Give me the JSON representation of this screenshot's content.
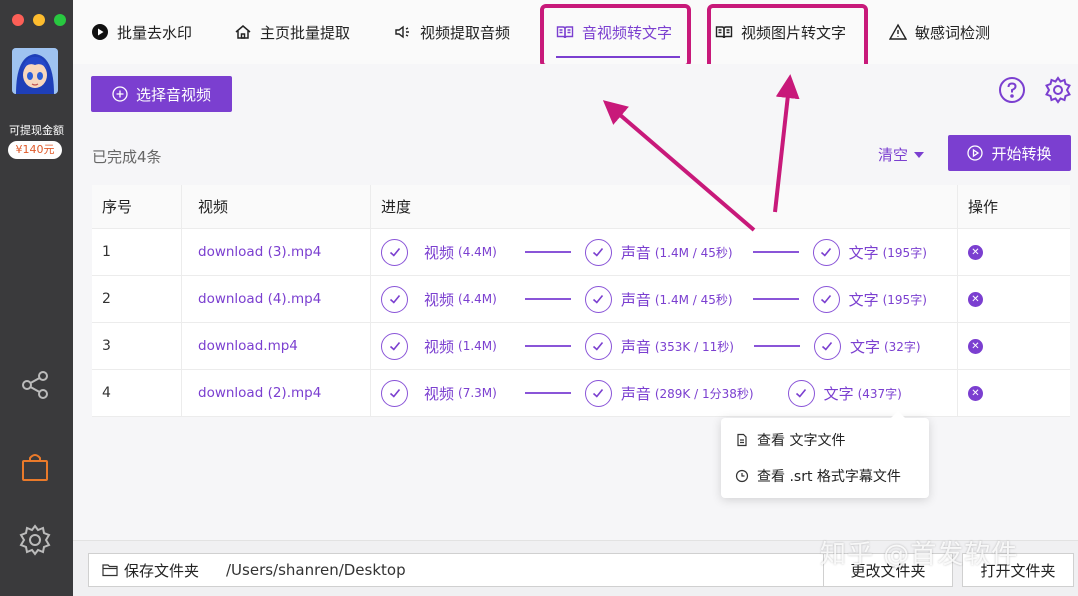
{
  "sidebar": {
    "balance_label": "可提现金额",
    "balance_value": "¥140元"
  },
  "tabs": [
    {
      "label": "批量去水印",
      "icon": "play-circle-icon"
    },
    {
      "label": "主页批量提取",
      "icon": "home-icon"
    },
    {
      "label": "视频提取音频",
      "icon": "speaker-icon"
    },
    {
      "label": "音视频转文字",
      "icon": "book-icon",
      "active": true
    },
    {
      "label": "视频图片转文字",
      "icon": "book-icon"
    },
    {
      "label": "敏感词检测",
      "icon": "warning-icon"
    }
  ],
  "toolbar": {
    "select_label": "选择音视频",
    "done_text": "已完成4条",
    "clear_label": "清空",
    "start_label": "开始转换"
  },
  "table": {
    "headers": [
      "序号",
      "视频",
      "进度",
      "操作"
    ],
    "rows": [
      {
        "num": "1",
        "file": "download (3).mp4",
        "video": "视频",
        "video_sub": "(4.4M)",
        "audio": "声音",
        "audio_sub": "(1.4M / 45秒)",
        "text": "文字",
        "text_sub": "(195字)"
      },
      {
        "num": "2",
        "file": "download (4).mp4",
        "video": "视频",
        "video_sub": "(4.4M)",
        "audio": "声音",
        "audio_sub": "(1.4M / 45秒)",
        "text": "文字",
        "text_sub": "(195字)"
      },
      {
        "num": "3",
        "file": "download.mp4",
        "video": "视频",
        "video_sub": "(1.4M)",
        "audio": "声音",
        "audio_sub": "(353K / 11秒)",
        "text": "文字",
        "text_sub": "(32字)"
      },
      {
        "num": "4",
        "file": "download (2).mp4",
        "video": "视频",
        "video_sub": "(7.3M)",
        "audio": "声音",
        "audio_sub": "(289K / 1分38秒)",
        "text": "文字",
        "text_sub": "(437字)"
      }
    ]
  },
  "popup": {
    "item1": "查看 文字文件",
    "item2": "查看 .srt 格式字幕文件"
  },
  "footer": {
    "save_folder_label": "保存文件夹",
    "path": "/Users/shanren/Desktop",
    "change_label": "更改文件夹",
    "open_label": "打开文件夹"
  },
  "watermark": "知乎 @首发软件",
  "colors": {
    "accent": "#7b3fd0",
    "highlight": "#c8197a",
    "sidebar": "#3a3a3c",
    "balance": "#e05a2a"
  }
}
